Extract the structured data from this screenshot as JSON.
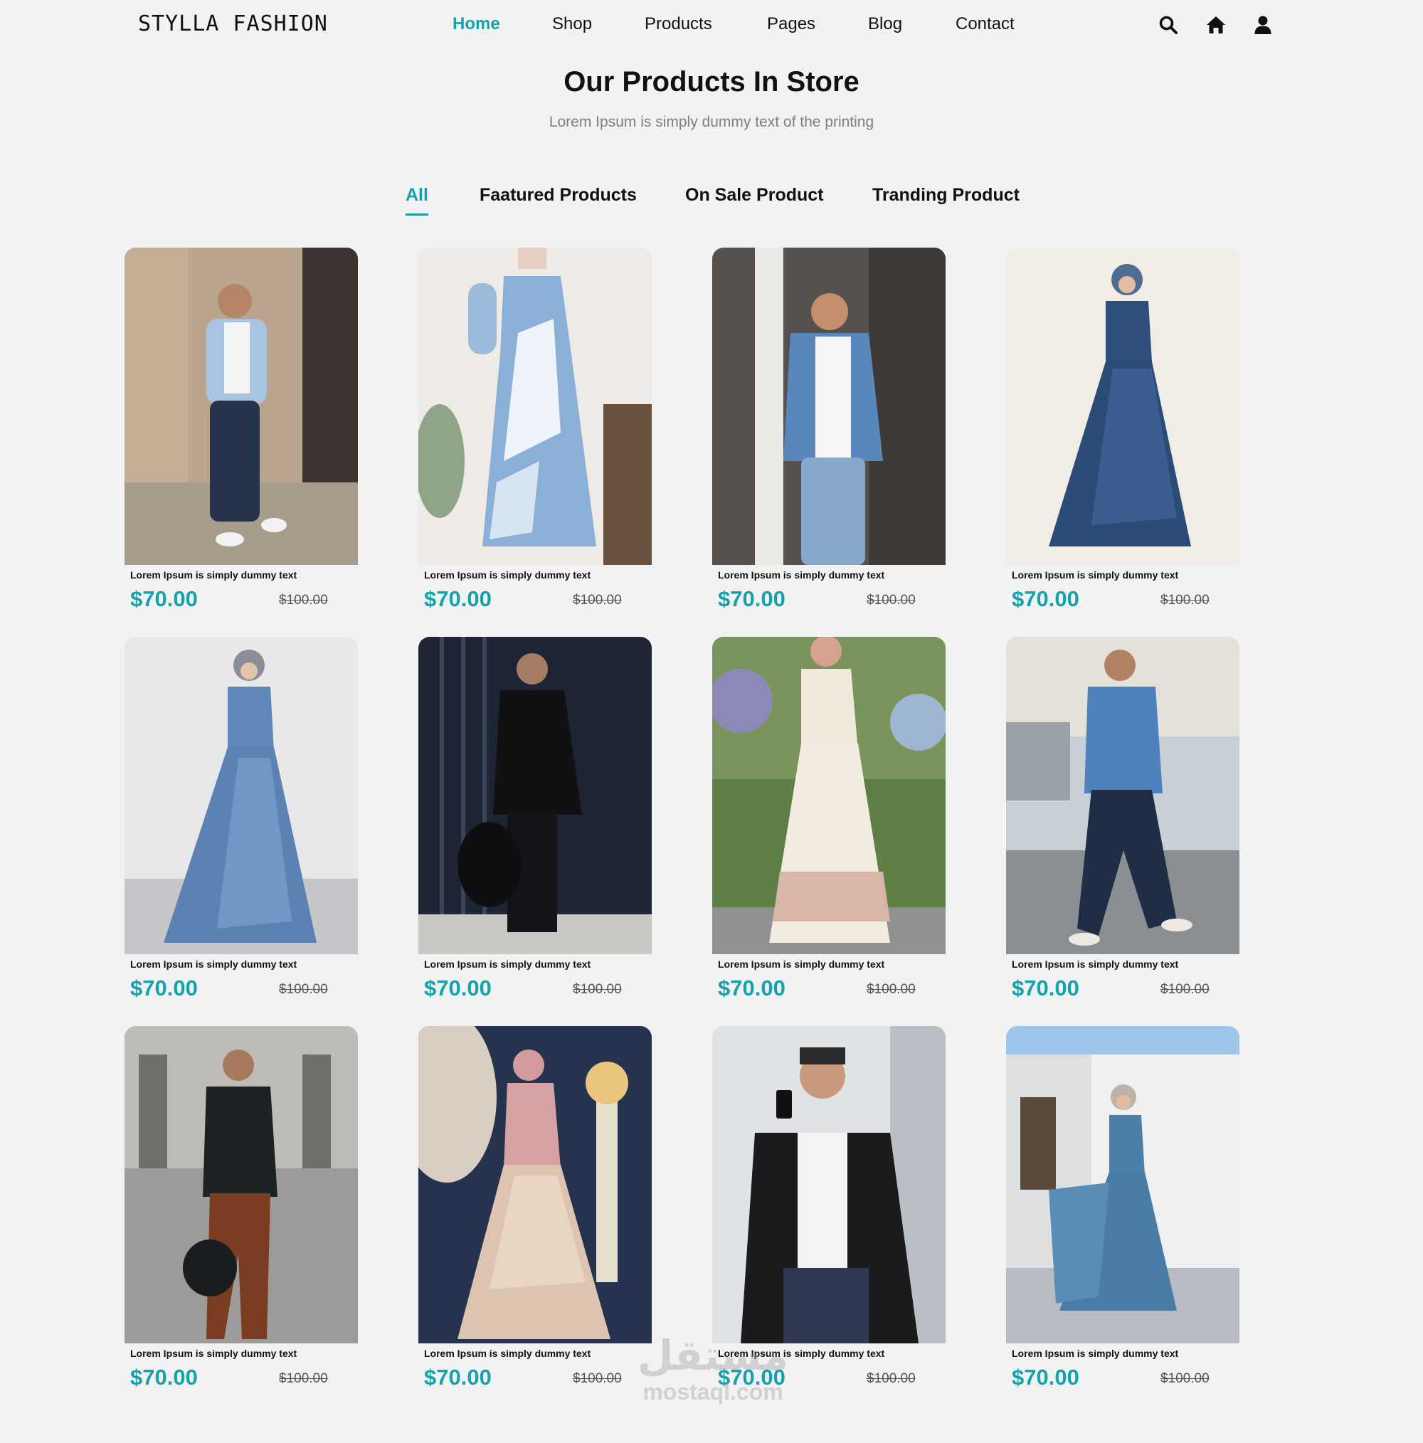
{
  "header": {
    "brand": "STYLLA FASHION",
    "nav": [
      {
        "label": "Home",
        "active": true
      },
      {
        "label": "Shop",
        "active": false
      },
      {
        "label": "Products",
        "active": false
      },
      {
        "label": "Pages",
        "active": false
      },
      {
        "label": "Blog",
        "active": false
      },
      {
        "label": "Contact",
        "active": false
      }
    ],
    "icons": [
      "search-icon",
      "home-icon",
      "user-icon"
    ]
  },
  "section": {
    "title": "Our Products In Store",
    "subtitle": "Lorem Ipsum is simply dummy text of the printing"
  },
  "tabs": [
    {
      "label": "All",
      "active": true
    },
    {
      "label": "Faatured Products",
      "active": false
    },
    {
      "label": "On Sale Product",
      "active": false
    },
    {
      "label": "Tranding Product",
      "active": false
    }
  ],
  "products": [
    {
      "name": "Lorem Ipsum is simply dummy text",
      "price": "$70.00",
      "old_price": "$100.00",
      "image": "man-light-blue-shirt-photo"
    },
    {
      "name": "Lorem Ipsum is simply dummy text",
      "price": "$70.00",
      "old_price": "$100.00",
      "image": "woman-tie-dye-dress-photo"
    },
    {
      "name": "Lorem Ipsum is simply dummy text",
      "price": "$70.00",
      "old_price": "$100.00",
      "image": "man-denim-jacket-photo"
    },
    {
      "name": "Lorem Ipsum is simply dummy text",
      "price": "$70.00",
      "old_price": "$100.00",
      "image": "woman-navy-gown-photo"
    },
    {
      "name": "Lorem Ipsum is simply dummy text",
      "price": "$70.00",
      "old_price": "$100.00",
      "image": "woman-blue-satin-dress-photo"
    },
    {
      "name": "Lorem Ipsum is simply dummy text",
      "price": "$70.00",
      "old_price": "$100.00",
      "image": "man-leather-jacket-photo"
    },
    {
      "name": "Lorem Ipsum is simply dummy text",
      "price": "$70.00",
      "old_price": "$100.00",
      "image": "woman-floral-white-dress-photo"
    },
    {
      "name": "Lorem Ipsum is simply dummy text",
      "price": "$70.00",
      "old_price": "$100.00",
      "image": "man-denim-shirt-street-photo"
    },
    {
      "name": "Lorem Ipsum is simply dummy text",
      "price": "$70.00",
      "old_price": "$100.00",
      "image": "man-black-hoodie-photo"
    },
    {
      "name": "Lorem Ipsum is simply dummy text",
      "price": "$70.00",
      "old_price": "$100.00",
      "image": "woman-sequin-gown-photo"
    },
    {
      "name": "Lorem Ipsum is simply dummy text",
      "price": "$70.00",
      "old_price": "$100.00",
      "image": "man-biker-jacket-photo"
    },
    {
      "name": "Lorem Ipsum is simply dummy text",
      "price": "$70.00",
      "old_price": "$100.00",
      "image": "woman-teal-dress-photo"
    }
  ],
  "watermark": {
    "arabic": "مستقل",
    "latin": "mostaql.com"
  },
  "colors": {
    "accent": "#14a2ab",
    "background": "#f2f2f2",
    "text": "#111111",
    "muted": "#7e7e7e"
  }
}
